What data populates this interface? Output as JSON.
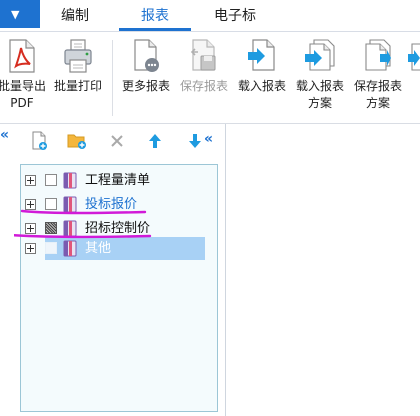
{
  "tabs": {
    "menu_caret": "▼",
    "items": [
      {
        "label": "编制"
      },
      {
        "label": "报表"
      },
      {
        "label": "电子标"
      }
    ]
  },
  "ribbon": {
    "buttons": [
      {
        "label_line1": "批量导出",
        "label_line2": "PDF",
        "icon": "pdf-export-icon",
        "disabled": false
      },
      {
        "label_line1": "批量打印",
        "label_line2": "",
        "icon": "printer-icon",
        "disabled": false
      },
      {
        "label_line1": "更多报表",
        "label_line2": "",
        "icon": "more-reports-icon",
        "disabled": false
      },
      {
        "label_line1": "保存报表",
        "label_line2": "",
        "icon": "save-report-icon",
        "disabled": true
      },
      {
        "label_line1": "载入报表",
        "label_line2": "",
        "icon": "load-report-icon",
        "disabled": false
      },
      {
        "label_line1": "载入报表",
        "label_line2": "方案",
        "icon": "load-scheme-icon",
        "disabled": false
      },
      {
        "label_line1": "保存报表",
        "label_line2": "方案",
        "icon": "save-scheme-icon",
        "disabled": false
      }
    ]
  },
  "panel": {
    "collapse_glyph": "«",
    "toolbar_chevron": "«",
    "tools": [
      {
        "icon": "new-file-icon"
      },
      {
        "icon": "new-folder-icon"
      },
      {
        "icon": "delete-icon"
      },
      {
        "icon": "move-up-icon"
      },
      {
        "icon": "move-down-icon"
      }
    ]
  },
  "tree": {
    "items": [
      {
        "label": "工程量清单",
        "checkbox": "unchecked",
        "style": "normal"
      },
      {
        "label": "投标报价",
        "checkbox": "unchecked",
        "style": "link"
      },
      {
        "label": "招标控制价",
        "checkbox": "partial",
        "style": "normal"
      },
      {
        "label": "其他",
        "checkbox": "unchecked",
        "style": "selected"
      }
    ]
  },
  "colors": {
    "accent": "#1e72d0",
    "annotation": "#d11ad8",
    "selection": "#a8d1f5",
    "tree_bg": "#f4fbfd"
  }
}
